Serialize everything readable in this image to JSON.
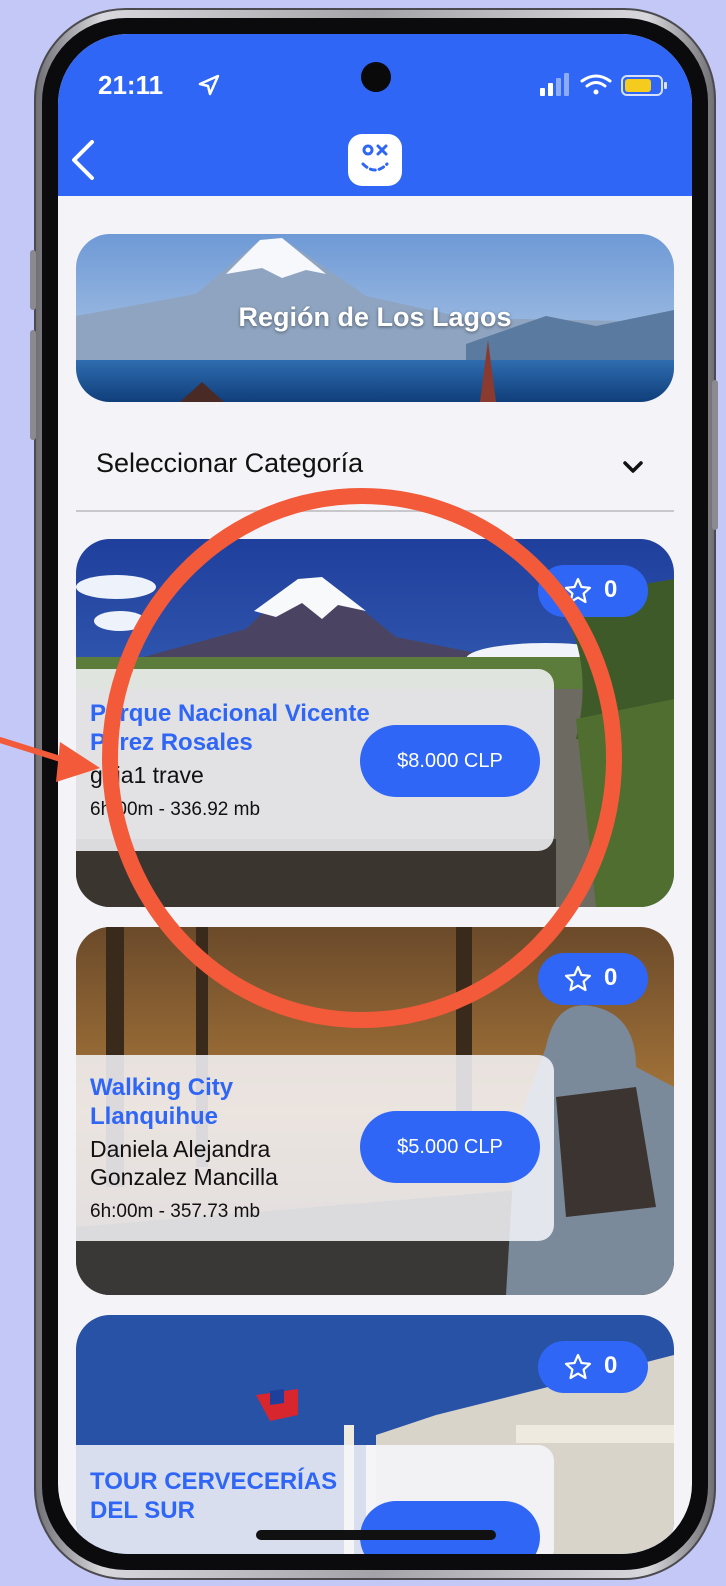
{
  "status_bar": {
    "time": "21:11"
  },
  "header": {
    "back_icon": "chevron-left-icon",
    "logo_icon": "smiley-face-logo"
  },
  "region": {
    "title": "Región de Los Lagos"
  },
  "category_select": {
    "selected": "Seleccionar Categoría",
    "icon": "chevron-down-icon"
  },
  "tours": [
    {
      "title": "Parque Nacional Vicente Perez Rosales",
      "author": "guia1 trave",
      "meta": "6h:00m - 336.92 mb",
      "price": "$8.000 CLP",
      "favorites": "0"
    },
    {
      "title": "Walking City Llanquihue",
      "author": "Daniela Alejandra Gonzalez Mancilla",
      "meta": "6h:00m - 357.73 mb",
      "price": "$5.000 CLP",
      "favorites": "0"
    },
    {
      "title": "TOUR CERVECERÍAS DEL SUR",
      "favorites": "0"
    }
  ],
  "colors": {
    "accent": "#2f66f6",
    "background": "#c3c8f6",
    "annotation": "#f25a3a"
  }
}
